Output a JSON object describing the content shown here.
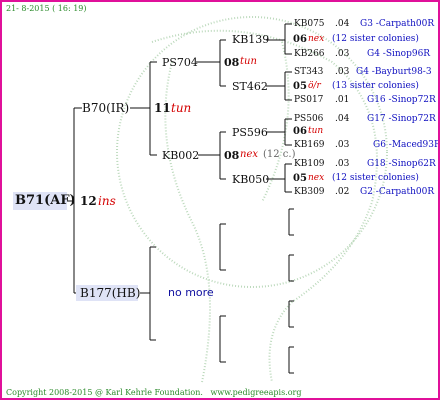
{
  "header": {
    "date": "21- 8-2015 ( 16: 19)"
  },
  "tree": {
    "root": {
      "name": "B71(AF)",
      "code": "12",
      "tag": "ins"
    },
    "sire": {
      "name": "B70(IR)",
      "code": "11",
      "tag": "tun"
    },
    "dam": {
      "name": "B177(HB)",
      "no_more": "no more"
    },
    "ss": {
      "name": "PS704",
      "code": "08",
      "tag": "tun"
    },
    "sd": {
      "name": "KB002",
      "code": "08",
      "tag": "nex",
      "note": "(12 c.)"
    },
    "g1": {
      "name": "KB139",
      "code": "06",
      "tag": "nex",
      "note": "(12 sister colonies)"
    },
    "g2": {
      "name": "ST462",
      "code": "05",
      "tag": "ö/r",
      "note": "(13 sister colonies)"
    },
    "g3": {
      "name": "PS596",
      "code": "06",
      "tag": "tun"
    },
    "g4": {
      "name": "KB050",
      "code": "05",
      "tag": "nex",
      "note": "(12 sister colonies)"
    },
    "gg": [
      {
        "name": "KB075",
        "num": ".04",
        "group": "G3 -Carpath00R"
      },
      {
        "name": "KB266",
        "num": ".03",
        "group": "G4 -Sinop96R"
      },
      {
        "name": "ST343",
        "num": ".03",
        "group": "G4 -Bayburt98-3"
      },
      {
        "name": "PS017",
        "num": ".01",
        "group": "G16 -Sinop72R"
      },
      {
        "name": "PS506",
        "num": ".04",
        "group": "G17 -Sinop72R"
      },
      {
        "name": "KB169",
        "num": ".03",
        "group": "G6 -Maced93R"
      },
      {
        "name": "KB109",
        "num": ".03",
        "group": "G18 -Sinop62R"
      },
      {
        "name": "KB309",
        "num": ".02",
        "group": "G2 -Carpath00R"
      }
    ]
  },
  "footer": {
    "copyright": "Copyright 2008-2015 @ Karl Kehrle Foundation.",
    "url": "www.pedigreeapis.org"
  }
}
